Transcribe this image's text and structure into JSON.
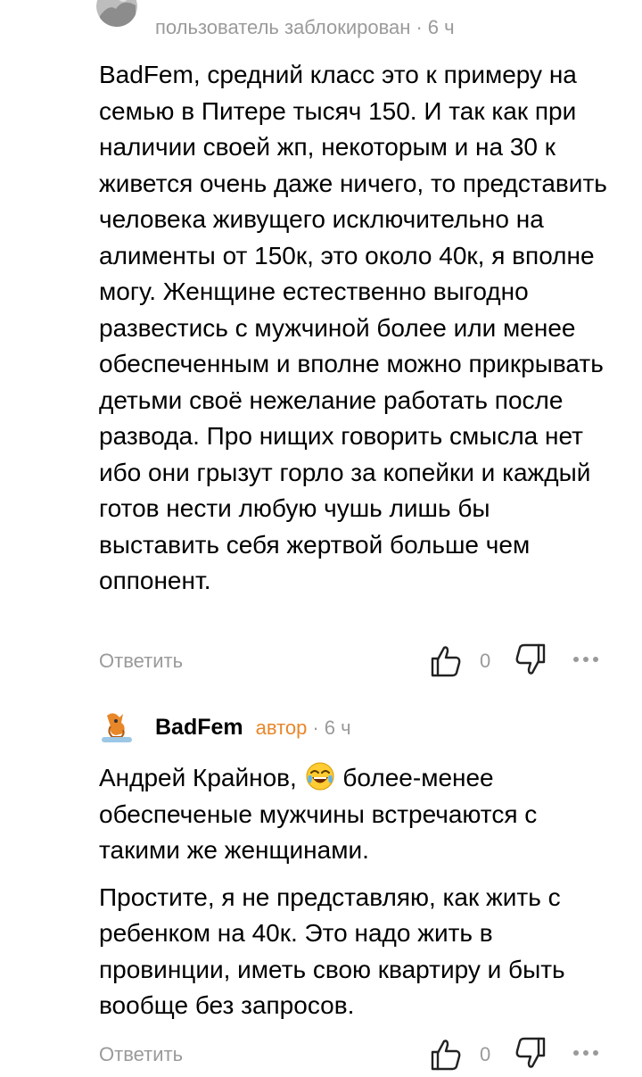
{
  "comments": [
    {
      "author": "",
      "status": "пользователь заблокирован",
      "time": "6 ч",
      "paragraphs": [
        "BadFem, средний класс это к примеру на семью в Питере тысяч 150. И так как при наличии своей жп, некоторым и на 30 к живется очень даже ничего, то представить человека живущего исключительно на алименты от 150к, это около 40к, я вполне могу. Женщине естественно выгодно развестись с мужчиной более или менее обеспеченным и вполне можно прикрывать детьми своё нежелание работать после развода. Про нищих говорить смысла нет ибо они грызут горло за копейки и каждый готов нести любую чушь лишь бы выставить себя жертвой больше чем оппонент."
      ],
      "reply_label": "Ответить",
      "like_count": "0"
    },
    {
      "author": "BadFem",
      "role": "автор",
      "time": "6 ч",
      "mention": "Андрей Крайнов,",
      "emoji": "face-with-tears-of-joy",
      "first_text": "более-менее обеспеченые мужчины встречаются с такими же женщинами.",
      "second_text": "Простите, я не представляю, как жить с ребенком на 40к. Это надо жить в провинции, иметь свою квартиру и быть вообще без запросов.",
      "reply_label": "Ответить",
      "like_count": "0"
    }
  ],
  "colors": {
    "meta": "#9a9a9a",
    "role": "#e8872a",
    "text": "#000000"
  }
}
